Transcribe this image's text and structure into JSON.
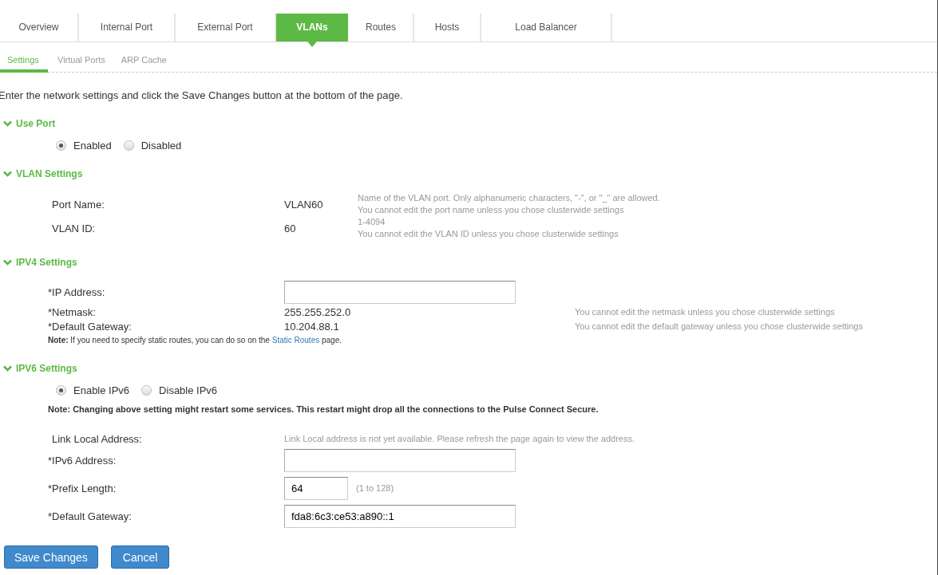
{
  "tabs": [
    {
      "label": "Overview",
      "selected": false
    },
    {
      "label": "Internal Port",
      "selected": false
    },
    {
      "label": "External Port",
      "selected": false
    },
    {
      "label": "VLANs",
      "selected": true
    },
    {
      "label": "Routes",
      "selected": false
    },
    {
      "label": "Hosts",
      "selected": false
    },
    {
      "label": "Load Balancer",
      "selected": false
    }
  ],
  "subtabs": [
    {
      "label": "Settings",
      "selected": true
    },
    {
      "label": "Virtual Ports",
      "selected": false
    },
    {
      "label": "ARP Cache",
      "selected": false
    }
  ],
  "intro": "Enter the network settings and click the Save Changes button at the bottom of the page.",
  "sections": [
    {
      "title": "Use Port",
      "expanded": true,
      "items": [
        {
          "kind": "radios",
          "options": [
            {
              "label": "Enabled",
              "selected": true
            },
            {
              "label": "Disabled",
              "selected": false
            }
          ]
        }
      ]
    },
    {
      "title": "VLAN Settings",
      "expanded": true,
      "items": [
        {
          "kind": "info",
          "label": "Port Name:",
          "value": "VLAN60",
          "hints": [
            "Name of the VLAN port. Only alphanumeric characters, \"-\", or \"_\" are allowed.",
            "You cannot edit the port name unless you chose clusterwide settings"
          ]
        },
        {
          "kind": "info",
          "label": "VLAN ID:",
          "value": "60",
          "hints": [
            "1-4094",
            "You cannot edit the VLAN ID unless you chose clusterwide settings"
          ]
        }
      ]
    },
    {
      "title": "IPV4 Settings",
      "expanded": true,
      "items": [
        {
          "kind": "input",
          "label": "*IP Address:",
          "value": ""
        },
        {
          "kind": "readonly",
          "label": "*Netmask:",
          "value": "255.255.252.0",
          "hint": "You cannot edit the netmask unless you chose clusterwide settings"
        },
        {
          "kind": "readonly",
          "label": "*Default Gateway:",
          "value": "10.204.88.1",
          "hint": "You cannot edit the default gateway unless you chose clusterwide settings"
        },
        {
          "kind": "note",
          "text": "**Note:** If you need to specify static routes, you can do so on the",
          "link": "Static Routes",
          "after": "page."
        }
      ]
    },
    {
      "title": "IPV6 Settings",
      "expanded": true,
      "items": [
        {
          "kind": "radios",
          "options": [
            {
              "label": "Enable IPv6",
              "selected": true
            },
            {
              "label": "Disable IPv6",
              "selected": false
            }
          ]
        },
        {
          "kind": "warning",
          "text": "Note: Changing above setting might restart some services. This restart might drop all the connections to the Pulse Connect Secure."
        },
        {
          "kind": "message",
          "label": "Link Local Address:",
          "hint": "Link Local address is not yet available. Please refresh the page again to view the address."
        },
        {
          "kind": "input",
          "label": "*IPv6 Address:",
          "value": ""
        },
        {
          "kind": "short_input",
          "label": "*Prefix Length:",
          "value": "64",
          "hint": "(1 to 128)"
        },
        {
          "kind": "input",
          "label": "*Default Gateway:",
          "value": "fda8:6c3:ce53:a890::1"
        }
      ]
    }
  ],
  "buttons": [
    "Save Changes",
    "Cancel"
  ]
}
